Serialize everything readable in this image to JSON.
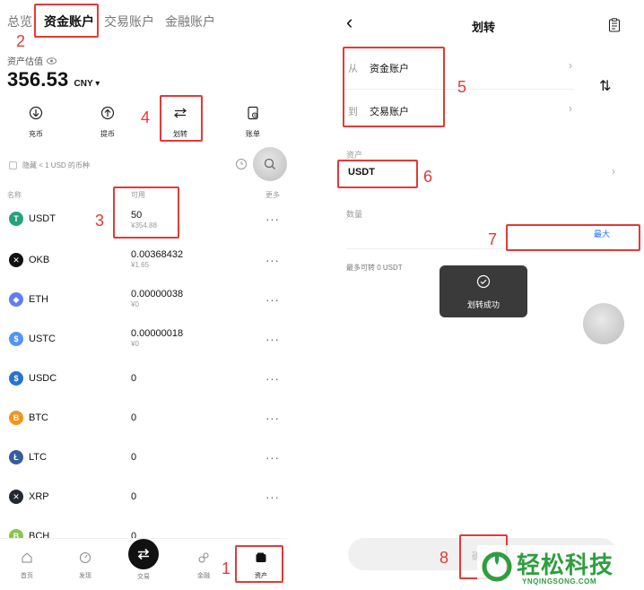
{
  "left": {
    "tabs": [
      "总览",
      "资金账户",
      "交易账户",
      "金融账户"
    ],
    "asset_label": "资产估值",
    "asset_value": "356.53",
    "currency": "CNY",
    "actions": [
      {
        "label": "充币",
        "icon": "deposit-icon"
      },
      {
        "label": "提币",
        "icon": "withdraw-icon"
      },
      {
        "label": "划转",
        "icon": "transfer-icon"
      },
      {
        "label": "账单",
        "icon": "bill-icon"
      }
    ],
    "hide_small_label": "隐藏 < 1 USD 的币种",
    "col_name": "名称",
    "col_available": "可用",
    "col_more": "更多",
    "coins": [
      {
        "name": "USDT",
        "amount": "50",
        "sub": "¥354.88",
        "color": "#26a17b",
        "glyph": "T"
      },
      {
        "name": "OKB",
        "amount": "0.00368432",
        "sub": "¥1.65",
        "color": "#111111",
        "glyph": "✕"
      },
      {
        "name": "ETH",
        "amount": "0.00000038",
        "sub": "¥0",
        "color": "#627eea",
        "glyph": "◆"
      },
      {
        "name": "USTC",
        "amount": "0.00000018",
        "sub": "¥0",
        "color": "#5493f7",
        "glyph": "$"
      },
      {
        "name": "USDC",
        "amount": "0",
        "sub": "",
        "color": "#2775ca",
        "glyph": "$"
      },
      {
        "name": "BTC",
        "amount": "0",
        "sub": "",
        "color": "#f7931a",
        "glyph": "B"
      },
      {
        "name": "LTC",
        "amount": "0",
        "sub": "",
        "color": "#345d9d",
        "glyph": "Ł"
      },
      {
        "name": "XRP",
        "amount": "0",
        "sub": "",
        "color": "#23292f",
        "glyph": "✕"
      },
      {
        "name": "BCH",
        "amount": "0",
        "sub": "",
        "color": "#8dc351",
        "glyph": "B"
      }
    ],
    "more_glyph": "···",
    "nav": [
      {
        "label": "首页",
        "icon": "home-icon"
      },
      {
        "label": "发现",
        "icon": "discover-icon"
      },
      {
        "label": "交易",
        "icon": "trade-icon"
      },
      {
        "label": "金融",
        "icon": "finance-icon"
      },
      {
        "label": "资产",
        "icon": "assets-icon"
      }
    ]
  },
  "right": {
    "back_glyph": "‹",
    "title": "划转",
    "from_label": "从",
    "from_value": "资金账户",
    "to_label": "到",
    "to_value": "交易账户",
    "swap_glyph": "⇅",
    "asset_label": "资产",
    "asset_value": "USDT",
    "quantity_label": "数量",
    "max_label": "最大",
    "max_transferable": "最多可转 0 USDT",
    "toast_text": "划转成功",
    "confirm_partial": "确"
  },
  "annotations": [
    "1",
    "2",
    "3",
    "4",
    "5",
    "6",
    "7",
    "8"
  ],
  "watermark": {
    "cn": "轻松科技",
    "en": "YNQINGSONG.COM"
  }
}
